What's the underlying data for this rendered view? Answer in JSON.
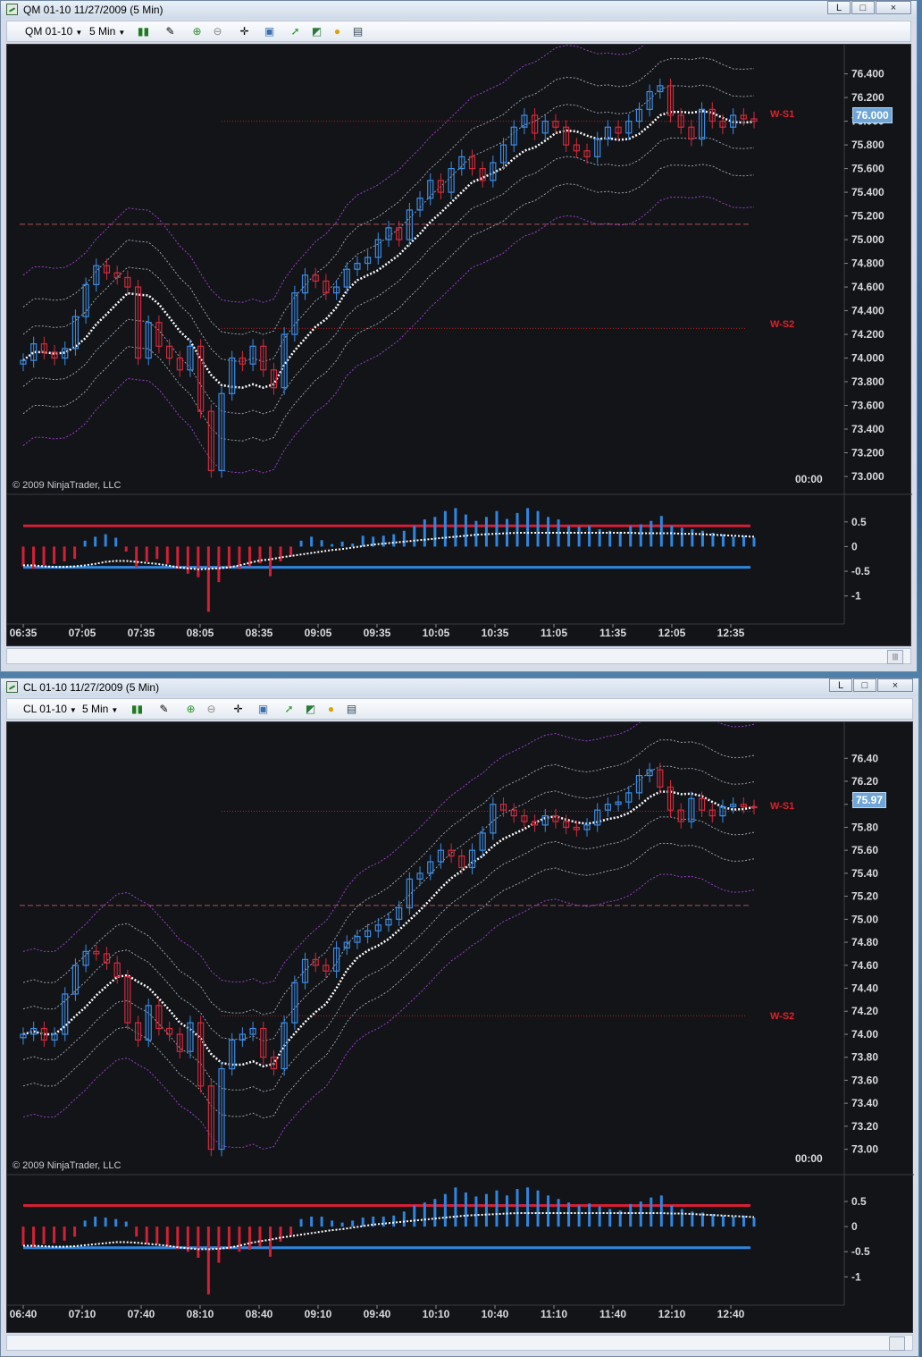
{
  "windows": [
    {
      "title": "QM 01-10  11/27/2009 (5 Min)",
      "instrument_selector": "QM 01-10",
      "period_selector": "5 Min",
      "copyright": "© 2009 NinjaTrader, LLC",
      "time_label": "00:00",
      "last_price": "76.000",
      "level_labels": [
        "W-S1",
        "W-S2"
      ],
      "price_axis": [
        "76.400",
        "76.200",
        "76.000",
        "75.800",
        "75.600",
        "75.400",
        "75.200",
        "75.000",
        "74.800",
        "74.600",
        "74.400",
        "74.200",
        "74.000",
        "73.800",
        "73.600",
        "73.400",
        "73.200",
        "73.000"
      ],
      "osc_axis": [
        "0.5",
        "0",
        "-0.5",
        "-1"
      ],
      "time_axis": [
        "06:35",
        "07:05",
        "07:35",
        "08:05",
        "08:35",
        "09:05",
        "09:35",
        "10:05",
        "10:35",
        "11:05",
        "11:35",
        "12:05",
        "12:35"
      ]
    },
    {
      "title": "CL 01-10  11/27/2009 (5 Min)",
      "instrument_selector": "CL 01-10",
      "period_selector": "5 Min",
      "copyright": "© 2009 NinjaTrader, LLC",
      "time_label": "00:00",
      "last_price": "75.97",
      "level_labels": [
        "W-S1",
        "W-S2"
      ],
      "price_axis": [
        "76.40",
        "76.20",
        "76.00",
        "75.80",
        "75.60",
        "75.40",
        "75.20",
        "75.00",
        "74.80",
        "74.60",
        "74.40",
        "74.20",
        "74.00",
        "73.80",
        "73.60",
        "73.40",
        "73.20",
        "73.00"
      ],
      "osc_axis": [
        "0.5",
        "0",
        "-0.5",
        "-1"
      ],
      "time_axis": [
        "06:40",
        "07:10",
        "07:40",
        "08:10",
        "08:40",
        "09:10",
        "09:40",
        "10:10",
        "10:40",
        "11:10",
        "11:40",
        "12:10",
        "12:40"
      ]
    }
  ],
  "window_buttons": {
    "minimize": "L",
    "restore": "□",
    "close": "×"
  },
  "colors": {
    "background": "#121418",
    "up_candle": "#3c8de6",
    "down_candle": "#d42a3c",
    "band_inner": "#9aa3ad",
    "band_outer": "#9c3fc7",
    "midline": "#ffffff",
    "level_line": "#b02020",
    "osc_upper": "#d41f34",
    "osc_lower": "#2f86e0"
  },
  "chart_data": [
    {
      "type": "candlestick",
      "symbol": "QM 01-10",
      "ylim": [
        73.0,
        76.45
      ],
      "level_lines": {
        "W-S1": 76.0,
        "W-S2": 74.25,
        "dashed": 75.13
      },
      "closes": [
        73.98,
        74.12,
        74.05,
        74.0,
        74.08,
        74.35,
        74.62,
        74.78,
        74.72,
        74.68,
        74.6,
        74.0,
        74.3,
        74.1,
        74.0,
        73.9,
        74.1,
        73.55,
        73.05,
        73.7,
        74.0,
        73.95,
        74.1,
        73.9,
        73.75,
        74.2,
        74.55,
        74.7,
        74.65,
        74.55,
        74.6,
        74.75,
        74.8,
        74.85,
        75.0,
        75.1,
        75.0,
        75.25,
        75.35,
        75.5,
        75.4,
        75.6,
        75.7,
        75.6,
        75.5,
        75.65,
        75.8,
        75.95,
        76.05,
        75.9,
        76.0,
        75.95,
        75.8,
        75.75,
        75.7,
        75.85,
        75.95,
        75.9,
        76.0,
        76.1,
        76.25,
        76.3,
        76.05,
        75.95,
        75.85,
        76.1,
        76.0,
        75.95,
        76.05,
        76.02,
        76.0
      ],
      "oscillator": {
        "upper": 0.42,
        "lower": -0.42,
        "bars": [
          -0.4,
          -0.45,
          -0.38,
          -0.35,
          -0.3,
          -0.25,
          0.12,
          0.2,
          0.25,
          0.18,
          -0.1,
          -0.42,
          -0.3,
          -0.25,
          -0.35,
          -0.45,
          -0.55,
          -0.62,
          -1.32,
          -0.72,
          -0.44,
          -0.46,
          -0.4,
          -0.34,
          -0.6,
          -0.3,
          -0.2,
          0.12,
          0.2,
          0.13,
          0.05,
          0.1,
          0.06,
          0.22,
          0.2,
          0.22,
          0.25,
          0.32,
          0.42,
          0.55,
          0.6,
          0.72,
          0.78,
          0.65,
          0.52,
          0.6,
          0.72,
          0.56,
          0.68,
          0.78,
          0.72,
          0.6,
          0.55,
          0.42,
          0.4,
          0.42,
          0.35,
          0.32,
          0.3,
          0.42,
          0.45,
          0.52,
          0.62,
          0.42,
          0.38,
          0.35,
          0.32,
          0.28,
          0.25,
          0.2,
          0.22,
          0.18
        ],
        "signal": [
          -0.38,
          -0.38,
          -0.4,
          -0.41,
          -0.41,
          -0.4,
          -0.38,
          -0.35,
          -0.31,
          -0.29,
          -0.29,
          -0.31,
          -0.33,
          -0.35,
          -0.38,
          -0.42,
          -0.44,
          -0.46,
          -0.45,
          -0.44,
          -0.42,
          -0.38,
          -0.33,
          -0.28,
          -0.26,
          -0.22,
          -0.19,
          -0.16,
          -0.13,
          -0.1,
          -0.07,
          -0.05,
          -0.02,
          0.01,
          0.04,
          0.06,
          0.08,
          0.1,
          0.12,
          0.14,
          0.16,
          0.18,
          0.2,
          0.22,
          0.24,
          0.25,
          0.26,
          0.27,
          0.28,
          0.28,
          0.28,
          0.28,
          0.28,
          0.28,
          0.28,
          0.28,
          0.28,
          0.28,
          0.28,
          0.28,
          0.27,
          0.27,
          0.27,
          0.27,
          0.26,
          0.26,
          0.25,
          0.24,
          0.23,
          0.22,
          0.21,
          0.2
        ]
      }
    },
    {
      "type": "candlestick",
      "symbol": "CL 01-10",
      "ylim": [
        72.95,
        76.48
      ],
      "level_lines": {
        "W-S1": 75.94,
        "W-S2": 74.16,
        "dashed": 75.12
      },
      "closes": [
        74.0,
        74.05,
        73.95,
        74.0,
        74.35,
        74.6,
        74.72,
        74.7,
        74.62,
        74.5,
        74.1,
        73.95,
        74.25,
        74.05,
        74.0,
        73.85,
        74.1,
        73.55,
        73.0,
        73.7,
        73.95,
        74.0,
        74.05,
        73.8,
        73.7,
        74.1,
        74.45,
        74.65,
        74.6,
        74.55,
        74.75,
        74.8,
        74.85,
        74.9,
        74.95,
        75.0,
        75.1,
        75.35,
        75.4,
        75.5,
        75.6,
        75.55,
        75.45,
        75.6,
        75.75,
        76.0,
        75.95,
        75.9,
        75.85,
        75.82,
        75.9,
        75.85,
        75.8,
        75.78,
        75.82,
        75.95,
        76.0,
        76.02,
        76.1,
        76.25,
        76.3,
        76.15,
        75.95,
        75.85,
        76.05,
        75.95,
        75.9,
        75.98,
        76.0,
        75.98,
        75.97
      ],
      "oscillator": {
        "upper": 0.42,
        "lower": -0.42,
        "bars": [
          -0.38,
          -0.42,
          -0.35,
          -0.33,
          -0.28,
          -0.2,
          0.12,
          0.2,
          0.18,
          0.15,
          0.1,
          -0.2,
          -0.35,
          -0.35,
          -0.4,
          -0.45,
          -0.5,
          -0.62,
          -1.35,
          -0.72,
          -0.45,
          -0.5,
          -0.46,
          -0.4,
          -0.6,
          -0.3,
          -0.2,
          0.15,
          0.2,
          0.2,
          0.12,
          0.08,
          0.12,
          0.18,
          0.2,
          0.2,
          0.22,
          0.3,
          0.42,
          0.48,
          0.55,
          0.65,
          0.78,
          0.68,
          0.6,
          0.65,
          0.72,
          0.62,
          0.75,
          0.78,
          0.72,
          0.62,
          0.55,
          0.48,
          0.42,
          0.46,
          0.4,
          0.35,
          0.32,
          0.45,
          0.5,
          0.58,
          0.62,
          0.42,
          0.35,
          0.3,
          0.28,
          0.25,
          0.22,
          0.2,
          0.22,
          0.18
        ],
        "signal": [
          -0.38,
          -0.38,
          -0.39,
          -0.4,
          -0.4,
          -0.39,
          -0.37,
          -0.35,
          -0.33,
          -0.31,
          -0.31,
          -0.32,
          -0.34,
          -0.36,
          -0.38,
          -0.41,
          -0.43,
          -0.45,
          -0.45,
          -0.44,
          -0.42,
          -0.38,
          -0.33,
          -0.29,
          -0.26,
          -0.22,
          -0.19,
          -0.16,
          -0.13,
          -0.1,
          -0.07,
          -0.05,
          -0.02,
          0.01,
          0.04,
          0.06,
          0.08,
          0.1,
          0.12,
          0.14,
          0.16,
          0.18,
          0.2,
          0.22,
          0.23,
          0.24,
          0.25,
          0.26,
          0.27,
          0.27,
          0.27,
          0.27,
          0.27,
          0.27,
          0.27,
          0.27,
          0.27,
          0.27,
          0.27,
          0.27,
          0.27,
          0.27,
          0.27,
          0.26,
          0.26,
          0.25,
          0.24,
          0.23,
          0.22,
          0.21,
          0.2,
          0.19
        ]
      }
    }
  ]
}
